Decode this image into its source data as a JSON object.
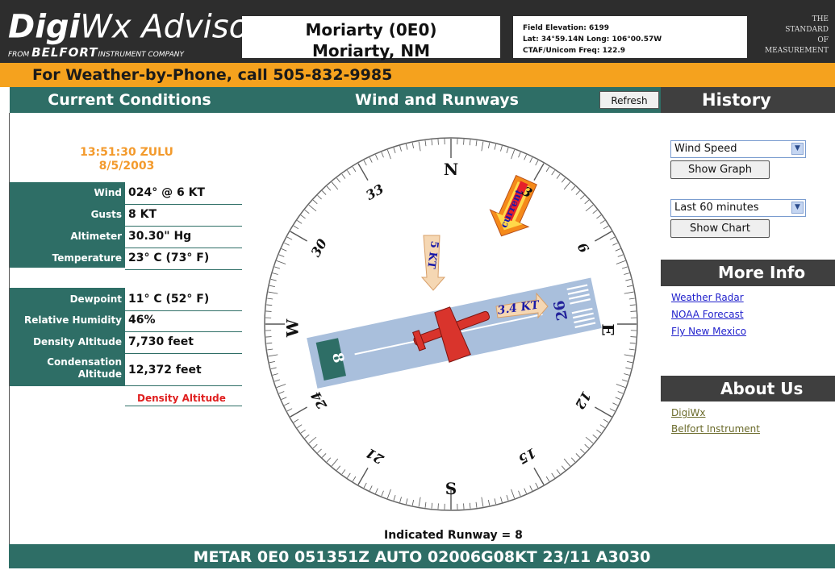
{
  "header": {
    "logo_title_bold": "Digi",
    "logo_title_rest": "Wx Advisor",
    "logo_tm": "™",
    "logo_sub_from": "FROM",
    "logo_sub_brand": "BELFORT",
    "logo_sub_company": "INSTRUMENT COMPANY",
    "station_line1": "Moriarty (0E0)",
    "station_line2": "Moriarty, NM",
    "field_elevation": "Field Elevation: 6199",
    "lat_long": "Lat: 34°59.14N  Long: 106°00.57W",
    "ctaf": "CTAF/Unicom Freq: 122.9",
    "tagline": [
      "THE",
      "STANDARD",
      "OF",
      "MEASUREMENT"
    ]
  },
  "phone_banner": "For Weather-by-Phone, call 505-832-9985",
  "current_conditions": {
    "title": "Current Conditions",
    "time": "13:51:30 ZULU",
    "date": "8/5/2003",
    "rows1": [
      {
        "label": "Wind",
        "value": "024° @ 6 KT"
      },
      {
        "label": "Gusts",
        "value": "8 KT"
      },
      {
        "label": "Altimeter",
        "value": "30.30\" Hg"
      },
      {
        "label": "Temperature",
        "value": "23° C (73° F)"
      }
    ],
    "rows2": [
      {
        "label": "Dewpoint",
        "value": "11° C (52° F)"
      },
      {
        "label": "Relative Humidity",
        "value": "46%"
      },
      {
        "label": "Density Altitude",
        "value": "7,730 feet"
      },
      {
        "label_line1": "Condensation",
        "label_line2": "Altitude",
        "value": "12,372 feet"
      }
    ],
    "density_altitude_link": "Density Altitude"
  },
  "wind_runways": {
    "title": "Wind and Runways",
    "refresh_label": "Refresh",
    "cardinals": {
      "n": "N",
      "e": "E",
      "s": "S",
      "w": "W"
    },
    "heading_labels": [
      "3",
      "6",
      "12",
      "15",
      "21",
      "24",
      "30",
      "33"
    ],
    "runway_end_a": "8",
    "runway_end_b": "26",
    "wind_arrow_label": "5 KT",
    "crosswind_label": "3.4 KT",
    "current_label": "current",
    "indicated_runway": "Indicated Runway = 8"
  },
  "history": {
    "title": "History",
    "select1_value": "Wind Speed",
    "show_graph_label": "Show Graph",
    "select2_value": "Last 60 minutes",
    "show_chart_label": "Show Chart"
  },
  "more_info": {
    "title": "More Info",
    "links": [
      "Weather Radar",
      "NOAA Forecast",
      "Fly New Mexico"
    ]
  },
  "about_us": {
    "title": "About Us",
    "links": [
      "DigiWx",
      "Belfort Instrument"
    ]
  },
  "metar": "METAR 0E0 051351Z AUTO 02006G08KT 23/11 A3030",
  "colors": {
    "teal": "#2e6e66",
    "orange_banner": "#f5a21e",
    "header_dark": "#2d2d2d",
    "history_dark": "#3f3f3f",
    "runway_blue": "#a9bfdc",
    "plane_red": "#d9342c"
  },
  "icons": {
    "plane": "airplane-icon",
    "wind_arrow": "wind-arrow-icon",
    "select_arrow": "chevron-down-icon"
  }
}
